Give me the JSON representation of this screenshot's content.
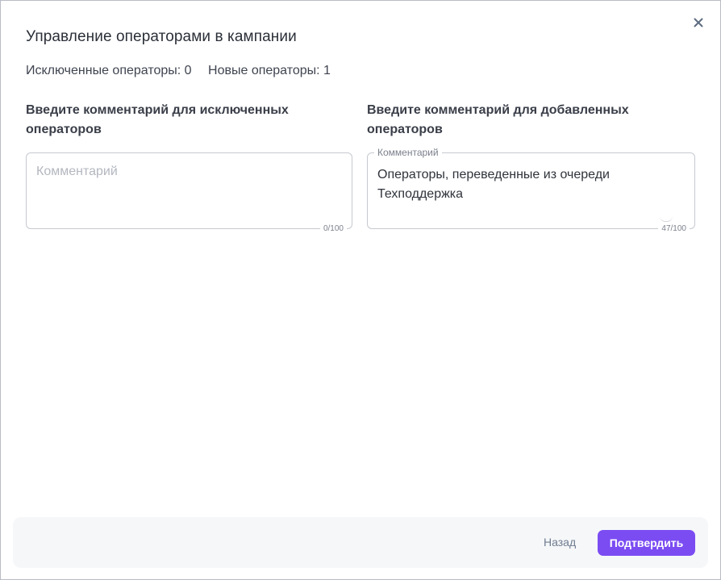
{
  "dialog": {
    "title": "Управление операторами в кампании",
    "close_icon": "close-icon"
  },
  "stats": {
    "excluded": "Исключенные операторы: 0",
    "new": "Новые операторы: 1"
  },
  "excluded_comment": {
    "label": "Введите комментарий для исключенных операторов",
    "placeholder": "Комментарий",
    "value": "",
    "counter": "0/100"
  },
  "added_comment": {
    "label": "Введите комментарий для добавленных операторов",
    "floating_label": "Комментарий",
    "value": "Операторы, переведенные из очереди Техподдержка",
    "counter": "47/100"
  },
  "footer": {
    "back_label": "Назад",
    "confirm_label": "Подтвердить",
    "accent_color": "#7b4cf2"
  }
}
